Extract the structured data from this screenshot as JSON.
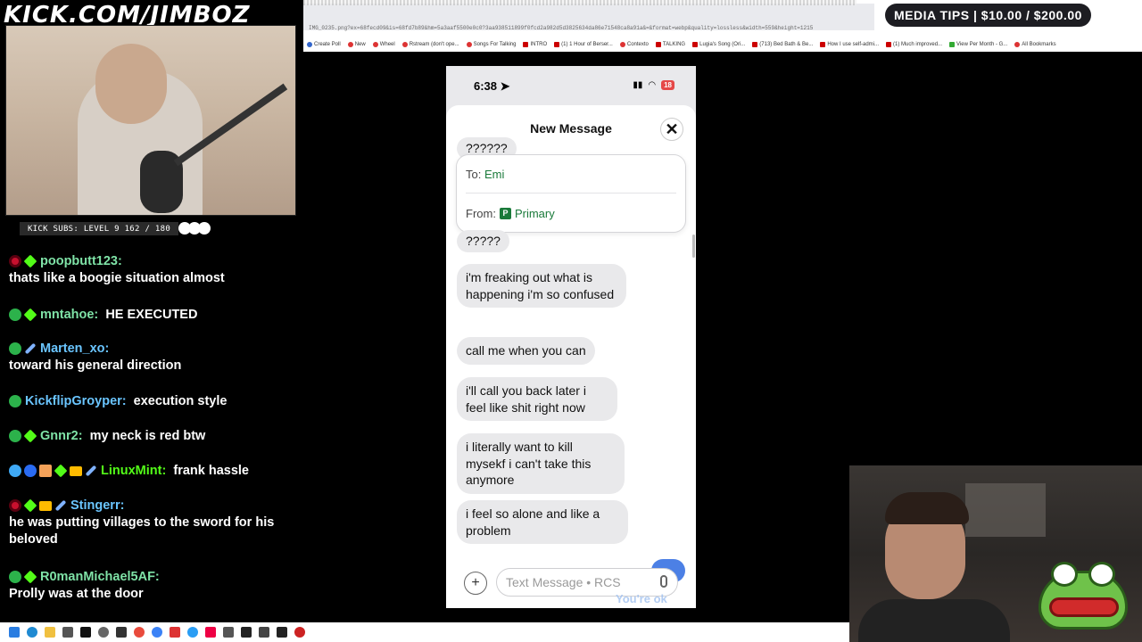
{
  "overlay": {
    "channel_url": "KICK.COM/JIMBOZ",
    "media_tips": "MEDIA TIPS | $10.00 / $200.00",
    "sub_counter": "KICK SUBS: LEVEL 9 162 / 180"
  },
  "browser": {
    "url": "IMG_0235.png?ex=68fecd09&is=68fd7b89&hm=5a3aaf5500e0c0?3aa938511899f0fcd2a982d5d3825634da86e71548ca8a91a&=&format=webp&quality=lossless&width=559&height=1215",
    "bookmarks": [
      {
        "label": "Create Poll",
        "icon": "poll-icon"
      },
      {
        "label": "New",
        "icon": "new-icon"
      },
      {
        "label": "Wheel",
        "icon": "wheel-icon"
      },
      {
        "label": "Rstream (don't ope...",
        "icon": "stream-icon"
      },
      {
        "label": "Songs For Talking",
        "icon": "music-icon"
      },
      {
        "label": "INTRO",
        "icon": "youtube-icon"
      },
      {
        "label": "(1) 1 Hour of Berser...",
        "icon": "youtube-icon"
      },
      {
        "label": "Contexto",
        "icon": "contexto-icon"
      },
      {
        "label": "TALKING",
        "icon": "youtube-icon"
      },
      {
        "label": "Lugia's Song (Ori...",
        "icon": "youtube-icon"
      },
      {
        "label": "(713) Bed Bath & Be...",
        "icon": "youtube-icon"
      },
      {
        "label": "How I use self-admi...",
        "icon": "youtube-icon"
      },
      {
        "label": "(1) Much improved...",
        "icon": "youtube-icon"
      },
      {
        "label": "View Per Month - G...",
        "icon": "sheets-icon"
      },
      {
        "label": "All Bookmarks",
        "icon": "folder-icon"
      }
    ]
  },
  "chat": {
    "messages": [
      {
        "user": "poopbutt123:",
        "text": "thats like a boogie situation almost",
        "color": "#7fe3a7"
      },
      {
        "user": "mntahoe:",
        "text": "HE EXECUTED",
        "color": "#7fe3a7"
      },
      {
        "user": "Marten_xo:",
        "text": "toward his general direction",
        "color": "#6ac5ff"
      },
      {
        "user": "KickflipGroyper:",
        "text": "execution style",
        "color": "#6ac5ff"
      },
      {
        "user": "Gnnr2:",
        "text": "my neck is red btw",
        "color": "#7fe3a7"
      },
      {
        "user": "LinuxMint:",
        "text": "frank hassle",
        "color": "#53fc18"
      },
      {
        "user": "Stingerr:",
        "text": "he was putting villages to the sword for his beloved",
        "color": "#6ac5ff"
      },
      {
        "user": "R0manMichael5AF:",
        "text": "Prolly was at the door",
        "color": "#7fe3a7"
      }
    ]
  },
  "phone": {
    "time": "6:38",
    "battery": "18",
    "sheet_title": "New Message",
    "to_label": "To:",
    "to_name": "Emi",
    "from_label": "From:",
    "from_value": "Primary",
    "from_chip": "P",
    "bubbles": [
      "??????",
      "?????",
      "i'm freaking out what is happening i'm so confused",
      "call me when you can",
      "i'll call you back later i feel like shit right now",
      "i literally want to kill mysekf i can't take this anymore",
      "i feel so alone and like a problem"
    ],
    "input_placeholder": "Text Message • RCS",
    "ghost_reply": "You're ok"
  }
}
